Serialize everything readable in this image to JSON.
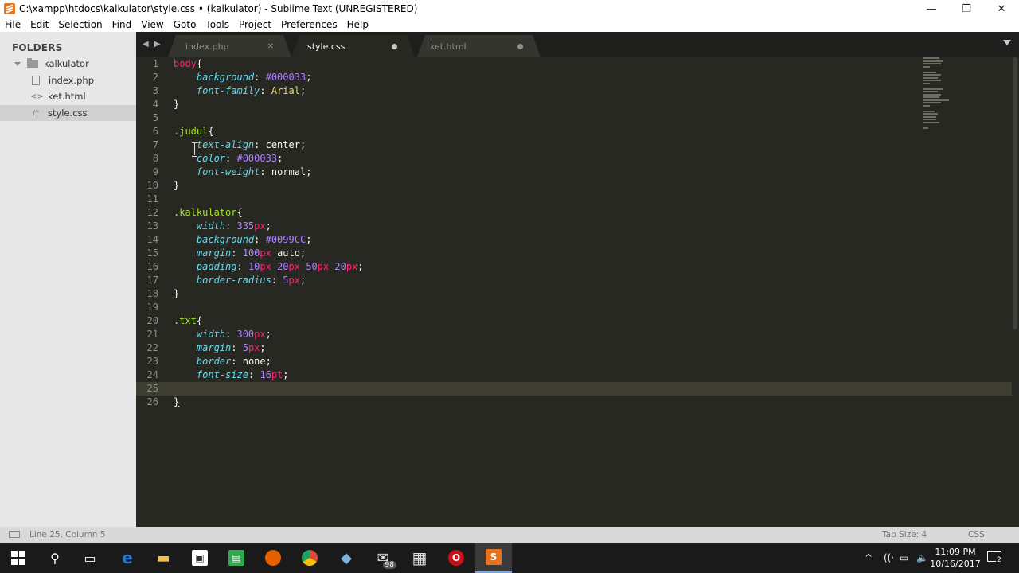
{
  "window": {
    "title": "C:\\xampp\\htdocs\\kalkulator\\style.css • (kalkulator) - Sublime Text (UNREGISTERED)",
    "controls": {
      "minimize": "—",
      "maximize": "❐",
      "close": "✕"
    }
  },
  "menu": [
    "File",
    "Edit",
    "Selection",
    "Find",
    "View",
    "Goto",
    "Tools",
    "Project",
    "Preferences",
    "Help"
  ],
  "sidebar": {
    "heading": "FOLDERS",
    "folder": "kalkulator",
    "files": [
      {
        "name": "index.php",
        "icon": "file-icon"
      },
      {
        "name": "ket.html",
        "icon": "html-file-icon",
        "glyph": "<>"
      },
      {
        "name": "style.css",
        "icon": "css-file-icon",
        "glyph": "/*",
        "selected": true
      }
    ]
  },
  "tabs": [
    {
      "label": "index.php",
      "state": "close",
      "close_glyph": "✕"
    },
    {
      "label": "style.css",
      "state": "modified",
      "active": true
    },
    {
      "label": "ket.html",
      "state": "modified"
    }
  ],
  "tab_nav": "◀ ▶",
  "editor": {
    "current_line": 25,
    "lines": [
      [
        [
          "t-tag",
          "body"
        ],
        [
          "t-br",
          "{"
        ]
      ],
      [
        [
          "",
          "    "
        ],
        [
          "t-prop",
          "background"
        ],
        [
          "",
          ": "
        ],
        [
          "t-num",
          "#000033"
        ],
        [
          "",
          ";"
        ]
      ],
      [
        [
          "",
          "    "
        ],
        [
          "t-prop",
          "font-family"
        ],
        [
          "",
          ": "
        ],
        [
          "t-val",
          "Arial"
        ],
        [
          "",
          ";"
        ]
      ],
      [
        [
          "t-br",
          "}"
        ]
      ],
      [],
      [
        [
          "t-cls",
          ".judul"
        ],
        [
          "t-br",
          "{"
        ]
      ],
      [
        [
          "",
          "    "
        ],
        [
          "t-prop",
          "text-align"
        ],
        [
          "",
          ": "
        ],
        [
          "",
          "center"
        ],
        [
          "",
          ";"
        ]
      ],
      [
        [
          "",
          "    "
        ],
        [
          "t-prop",
          "color"
        ],
        [
          "",
          ": "
        ],
        [
          "t-num",
          "#000033"
        ],
        [
          "",
          ";"
        ]
      ],
      [
        [
          "",
          "    "
        ],
        [
          "t-prop",
          "font-weight"
        ],
        [
          "",
          ": "
        ],
        [
          "",
          "normal"
        ],
        [
          "",
          ";"
        ]
      ],
      [
        [
          "t-br",
          "}"
        ]
      ],
      [],
      [
        [
          "t-cls",
          ".kalkulator"
        ],
        [
          "t-br",
          "{"
        ]
      ],
      [
        [
          "",
          "    "
        ],
        [
          "t-prop",
          "width"
        ],
        [
          "",
          ": "
        ],
        [
          "t-num",
          "335"
        ],
        [
          "t-unit",
          "px"
        ],
        [
          "",
          ";"
        ]
      ],
      [
        [
          "",
          "    "
        ],
        [
          "t-prop",
          "background"
        ],
        [
          "",
          ": "
        ],
        [
          "t-num",
          "#0099CC"
        ],
        [
          "",
          ";"
        ]
      ],
      [
        [
          "",
          "    "
        ],
        [
          "t-prop",
          "margin"
        ],
        [
          "",
          ": "
        ],
        [
          "t-num",
          "100"
        ],
        [
          "t-unit",
          "px"
        ],
        [
          "",
          " auto;"
        ]
      ],
      [
        [
          "",
          "    "
        ],
        [
          "t-prop",
          "padding"
        ],
        [
          "",
          ": "
        ],
        [
          "t-num",
          "10"
        ],
        [
          "t-unit",
          "px"
        ],
        [
          "",
          " "
        ],
        [
          "t-num",
          "20"
        ],
        [
          "t-unit",
          "px"
        ],
        [
          "",
          " "
        ],
        [
          "t-num",
          "50"
        ],
        [
          "t-unit",
          "px"
        ],
        [
          "",
          " "
        ],
        [
          "t-num",
          "20"
        ],
        [
          "t-unit",
          "px"
        ],
        [
          "",
          ";"
        ]
      ],
      [
        [
          "",
          "    "
        ],
        [
          "t-prop",
          "border-radius"
        ],
        [
          "",
          ": "
        ],
        [
          "t-num",
          "5"
        ],
        [
          "t-unit",
          "px"
        ],
        [
          "",
          ";"
        ]
      ],
      [
        [
          "t-br",
          "}"
        ]
      ],
      [],
      [
        [
          "t-cls",
          ".txt"
        ],
        [
          "t-br",
          "{"
        ]
      ],
      [
        [
          "",
          "    "
        ],
        [
          "t-prop",
          "width"
        ],
        [
          "",
          ": "
        ],
        [
          "t-num",
          "300"
        ],
        [
          "t-unit",
          "px"
        ],
        [
          "",
          ";"
        ]
      ],
      [
        [
          "",
          "    "
        ],
        [
          "t-prop",
          "margin"
        ],
        [
          "",
          ": "
        ],
        [
          "t-num",
          "5"
        ],
        [
          "t-unit",
          "px"
        ],
        [
          "",
          ";"
        ]
      ],
      [
        [
          "",
          "    "
        ],
        [
          "t-prop",
          "border"
        ],
        [
          "",
          ": "
        ],
        [
          "",
          "none"
        ],
        [
          "",
          ";"
        ]
      ],
      [
        [
          "",
          "    "
        ],
        [
          "t-prop",
          "font-size"
        ],
        [
          "",
          ": "
        ],
        [
          "t-num",
          "16"
        ],
        [
          "t-unit",
          "pt"
        ],
        [
          "",
          ";"
        ]
      ],
      [],
      [
        [
          "t-br cursor-bracket",
          "}"
        ]
      ]
    ]
  },
  "status": {
    "position": "Line 25, Column 5",
    "tab_size": "Tab Size: 4",
    "syntax": "CSS"
  },
  "taskbar": {
    "items": [
      {
        "name": "start-button",
        "icon": "windows-icon"
      },
      {
        "name": "search-button",
        "icon": "search-icon",
        "glyph": "⚲"
      },
      {
        "name": "task-view-button",
        "icon": "task-view-icon",
        "glyph": "▭"
      },
      {
        "name": "edge",
        "icon": "edge-icon",
        "glyph": "e",
        "color": "#1e78d7"
      },
      {
        "name": "file-explorer",
        "icon": "folder-icon",
        "glyph": "▬",
        "color": "#f0c044"
      },
      {
        "name": "store",
        "icon": "store-icon",
        "glyph": "🛍",
        "color": "#555555"
      },
      {
        "name": "notes-app",
        "icon": "notes-icon",
        "glyph": "▤",
        "color": "#2fa84f"
      },
      {
        "name": "firefox",
        "icon": "firefox-icon",
        "glyph": "●",
        "color": "#e66000"
      },
      {
        "name": "chrome",
        "icon": "chrome-icon",
        "glyph": "◉",
        "color": "#dd4b39"
      },
      {
        "name": "app-blue",
        "icon": "app-icon",
        "glyph": "◆",
        "color": "#7ab3e0"
      },
      {
        "name": "mail",
        "icon": "mail-icon",
        "glyph": "✉",
        "color": "#cccccc",
        "badge": "98"
      },
      {
        "name": "calculator",
        "icon": "calculator-icon",
        "glyph": "▦",
        "color": "#cccccc"
      },
      {
        "name": "opera",
        "icon": "opera-icon",
        "glyph": "O",
        "color": "#cc0f16"
      },
      {
        "name": "sublime-text",
        "icon": "sublime-icon",
        "glyph": "S",
        "color": "#e8731e",
        "active": true
      }
    ],
    "tray": {
      "chevron": "^",
      "wifi": "((·",
      "battery": "▭",
      "volume": "🔈"
    },
    "time": "11:09 PM",
    "date": "10/16/2017",
    "notifications": "2"
  },
  "colors": {
    "editor_bg": "#272822",
    "keyword": "#f92672",
    "class": "#a6e22e",
    "property": "#66d9ef",
    "number": "#ae81ff",
    "string": "#e6db74"
  }
}
